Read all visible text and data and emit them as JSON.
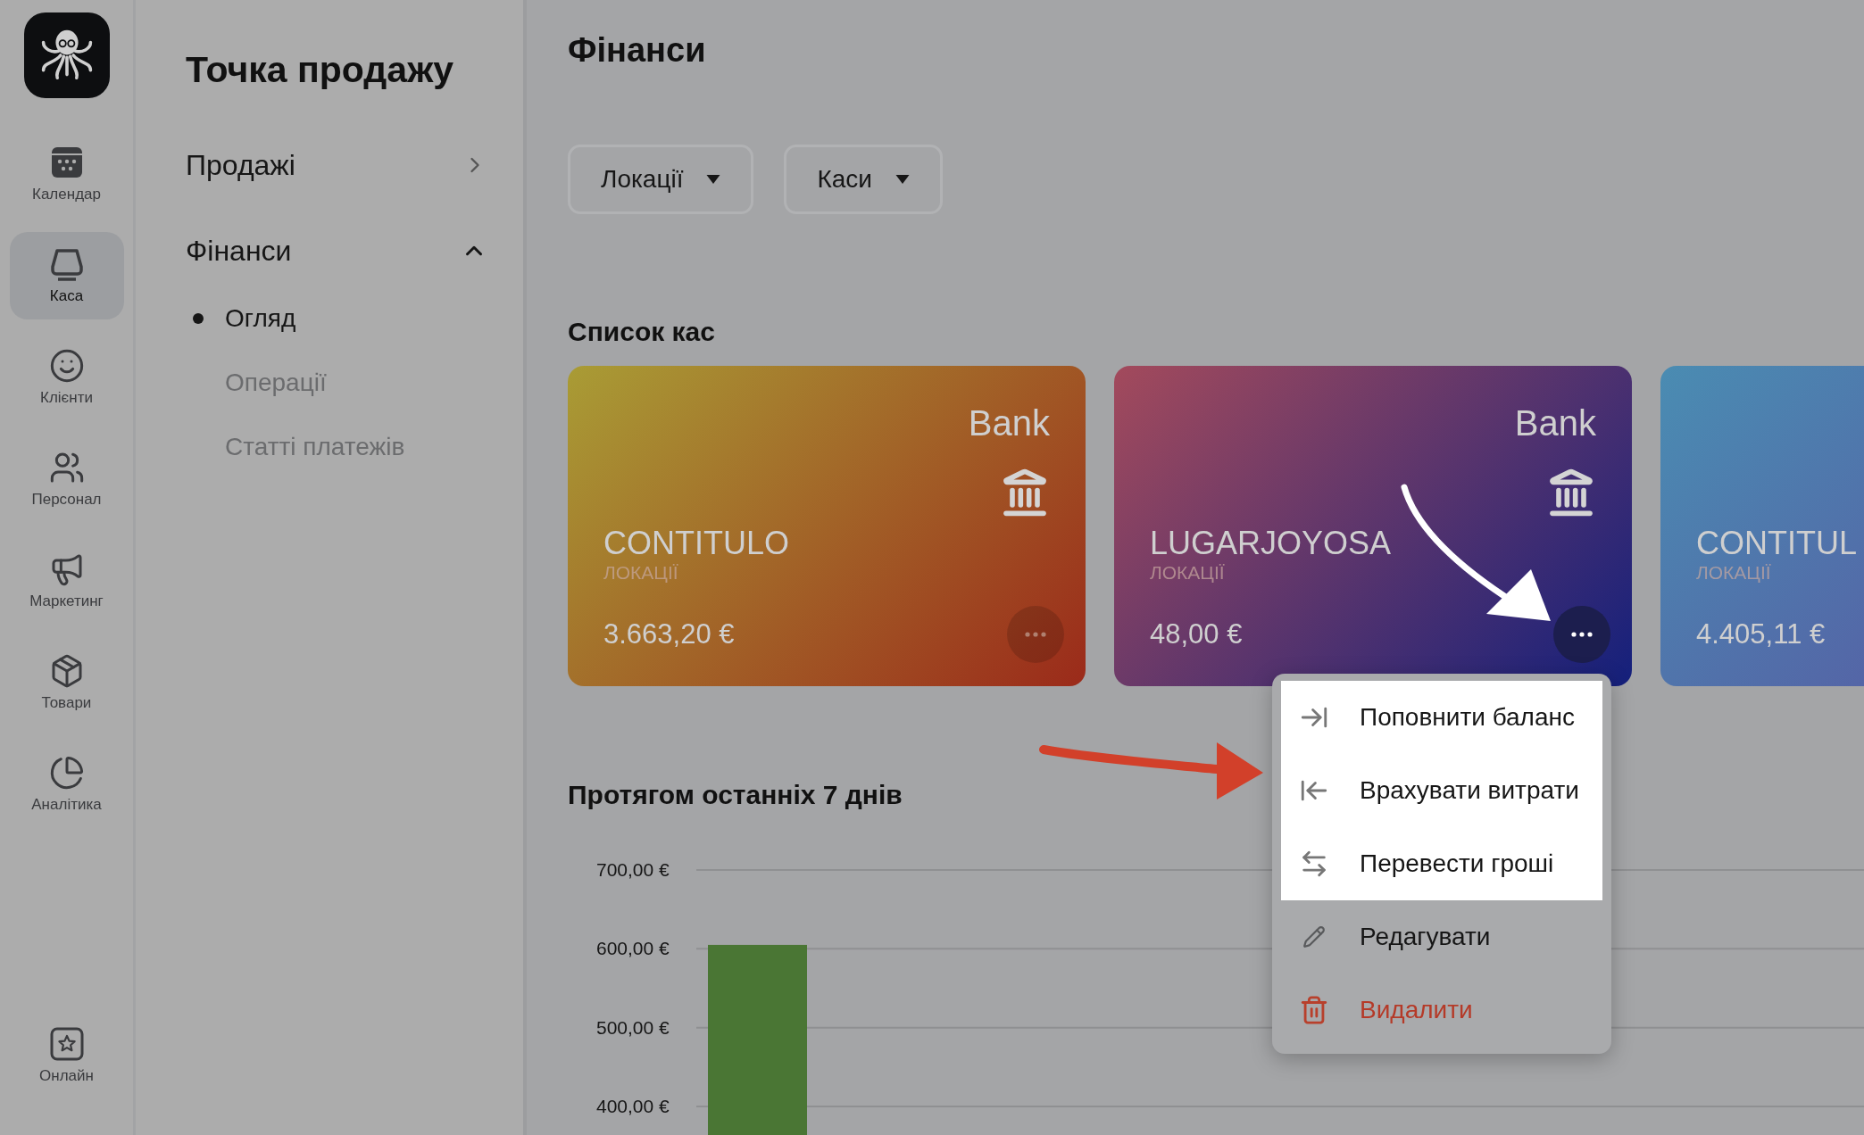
{
  "rail": {
    "items": [
      {
        "label": "Календар",
        "selected": false
      },
      {
        "label": "Каса",
        "selected": true
      },
      {
        "label": "Клієнти",
        "selected": false
      },
      {
        "label": "Персонал",
        "selected": false
      },
      {
        "label": "Маркетинг",
        "selected": false
      },
      {
        "label": "Товари",
        "selected": false
      },
      {
        "label": "Аналітика",
        "selected": false
      }
    ],
    "bottom": {
      "label": "Онлайн",
      "selected": false
    }
  },
  "sidebar": {
    "title": "Точка продажу",
    "sections": [
      {
        "label": "Продажі",
        "expanded": false
      },
      {
        "label": "Фінанси",
        "expanded": true,
        "children": [
          {
            "label": "Огляд",
            "selected": true
          },
          {
            "label": "Операції",
            "selected": false
          },
          {
            "label": "Статті платежів",
            "selected": false
          }
        ]
      }
    ]
  },
  "page": {
    "title": "Фінанси"
  },
  "filters": [
    "Локації",
    "Каси"
  ],
  "registers_title": "Список кас",
  "registers": [
    {
      "type": "Bank",
      "name": "CONTITULO",
      "location": "ЛОКАЦІЇ",
      "amount": "3.663,20 €",
      "menu_open": false
    },
    {
      "type": "Bank",
      "name": "LUGARJOYOSA",
      "location": "ЛОКАЦІЇ",
      "amount": "48,00 €",
      "menu_open": true
    },
    {
      "name": "CONTITUL",
      "location": "ЛОКАЦІЇ",
      "amount": "4.405,11 €"
    }
  ],
  "menu": [
    {
      "label": "Поповнити баланс",
      "kind": "normal",
      "highlighted": true
    },
    {
      "label": "Врахувати витрати",
      "kind": "normal",
      "highlighted": true
    },
    {
      "label": "Перевести гроші",
      "kind": "normal",
      "highlighted": true
    },
    {
      "label": "Редагувати",
      "kind": "normal",
      "highlighted": false
    },
    {
      "label": "Видалити",
      "kind": "danger",
      "highlighted": false
    }
  ],
  "chart": {
    "title": "Протягом останніх 7 днів",
    "chart_data": {
      "type": "bar",
      "grid": true,
      "ylim": [
        363,
        700
      ],
      "series": [
        {
          "color": "#4a7634",
          "values": [
            605
          ]
        }
      ],
      "yticks": [
        {
          "value": 700,
          "label": "700,00 €"
        },
        {
          "value": 600,
          "label": "600,00 €"
        },
        {
          "value": 500,
          "label": "500,00 €"
        },
        {
          "value": 400,
          "label": "400,00 €"
        }
      ]
    }
  }
}
